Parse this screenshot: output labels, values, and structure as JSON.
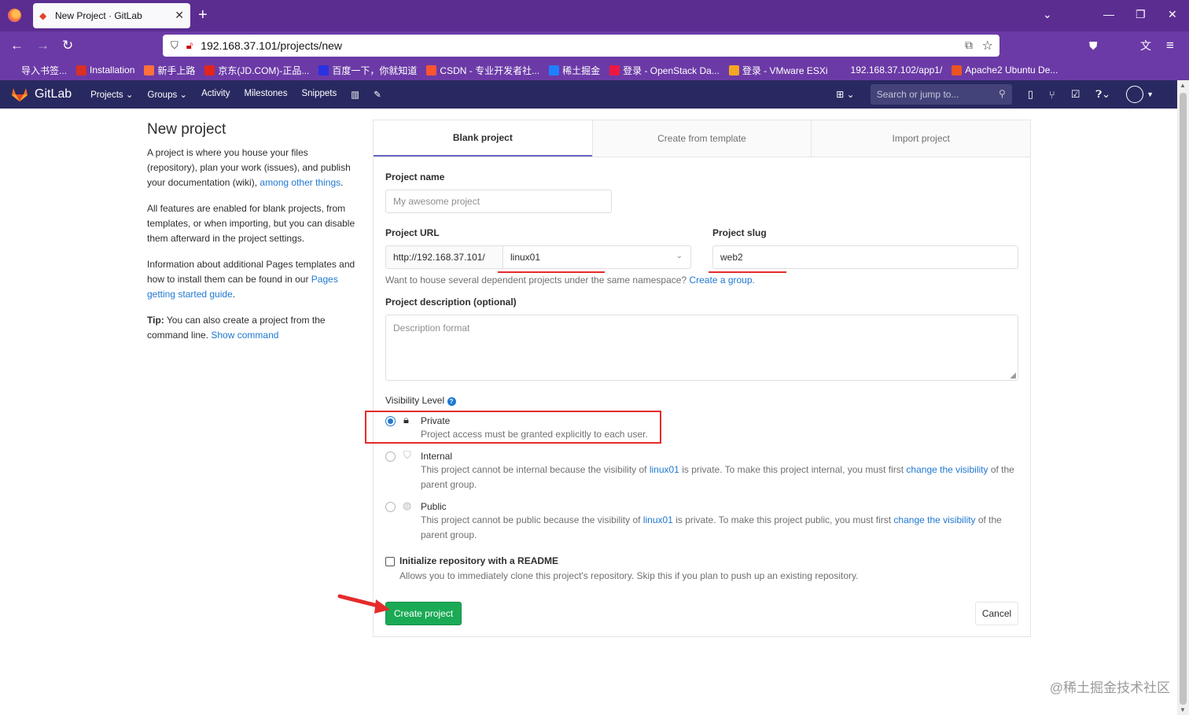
{
  "browser": {
    "tab_title": "New Project · GitLab",
    "url": "192.168.37.101/projects/new",
    "bookmarks": [
      {
        "label": "导入书签...",
        "color": "#6b3aa6"
      },
      {
        "label": "Installation",
        "color": "#d93025"
      },
      {
        "label": "新手上路",
        "color": "#ff7139"
      },
      {
        "label": "京东(JD.COM)-正品...",
        "color": "#e1251b"
      },
      {
        "label": "百度一下，你就知道",
        "color": "#2932e1"
      },
      {
        "label": "CSDN - 专业开发者社...",
        "color": "#fc5531"
      },
      {
        "label": "稀土掘金",
        "color": "#1e80ff"
      },
      {
        "label": "登录 - OpenStack Da...",
        "color": "#ed1944"
      },
      {
        "label": "登录 - VMware ESXi",
        "color": "#f5a623"
      },
      {
        "label": "192.168.37.102/app1/",
        "color": "#6b3aa6"
      },
      {
        "label": "Apache2 Ubuntu De...",
        "color": "#e95420"
      }
    ]
  },
  "gitlab_header": {
    "brand": "GitLab",
    "menu": [
      "Projects ⌄",
      "Groups ⌄",
      "Activity",
      "Milestones",
      "Snippets"
    ],
    "search_placeholder": "Search or jump to..."
  },
  "sidebar": {
    "title": "New project",
    "p1_text": "A project is where you house your files (repository), plan your work (issues), and publish your documentation (wiki), ",
    "p1_link": "among other things",
    "p1_end": ".",
    "p2": "All features are enabled for blank projects, from templates, or when importing, but you can disable them afterward in the project settings.",
    "p3_text": "Information about additional Pages templates and how to install them can be found in our ",
    "p3_link": "Pages getting started guide",
    "p3_end": ".",
    "tip_label": "Tip:",
    "tip_text": " You can also create a project from the command line. ",
    "tip_link": "Show command"
  },
  "tabs": [
    "Blank project",
    "Create from template",
    "Import project"
  ],
  "form": {
    "project_name_label": "Project name",
    "project_name_placeholder": "My awesome project",
    "project_url_label": "Project URL",
    "url_prefix": "http://192.168.37.101/",
    "namespace": "linux01",
    "slug_label": "Project slug",
    "slug_value": "web2",
    "namespace_help": "Want to house several dependent projects under the same namespace? ",
    "namespace_help_link": "Create a group.",
    "description_label": "Project description (optional)",
    "description_placeholder": "Description format",
    "visibility_label": "Visibility Level",
    "visibility": [
      {
        "title": "Private",
        "desc": "Project access must be granted explicitly to each user.",
        "checked": true
      },
      {
        "title": "Internal",
        "desc_a": "This project cannot be internal because the visibility of ",
        "desc_link1": "linux01",
        "desc_b": " is private. To make this project internal, you must first ",
        "desc_link2": "change the visibility",
        "desc_c": " of the parent group."
      },
      {
        "title": "Public",
        "desc_a": "This project cannot be public because the visibility of ",
        "desc_link1": "linux01",
        "desc_b": " is private. To make this project public, you must first ",
        "desc_link2": "change the visibility",
        "desc_c": " of the parent group."
      }
    ],
    "readme_label": "Initialize repository with a README",
    "readme_desc": "Allows you to immediately clone this project's repository. Skip this if you plan to push up an existing repository.",
    "create_button": "Create project",
    "cancel_button": "Cancel"
  },
  "watermark": "@稀土掘金技术社区",
  "colors": {
    "accent": "#1f78d1",
    "create": "#1aaa55",
    "header": "#292961",
    "highlight": "#e52b2b"
  }
}
